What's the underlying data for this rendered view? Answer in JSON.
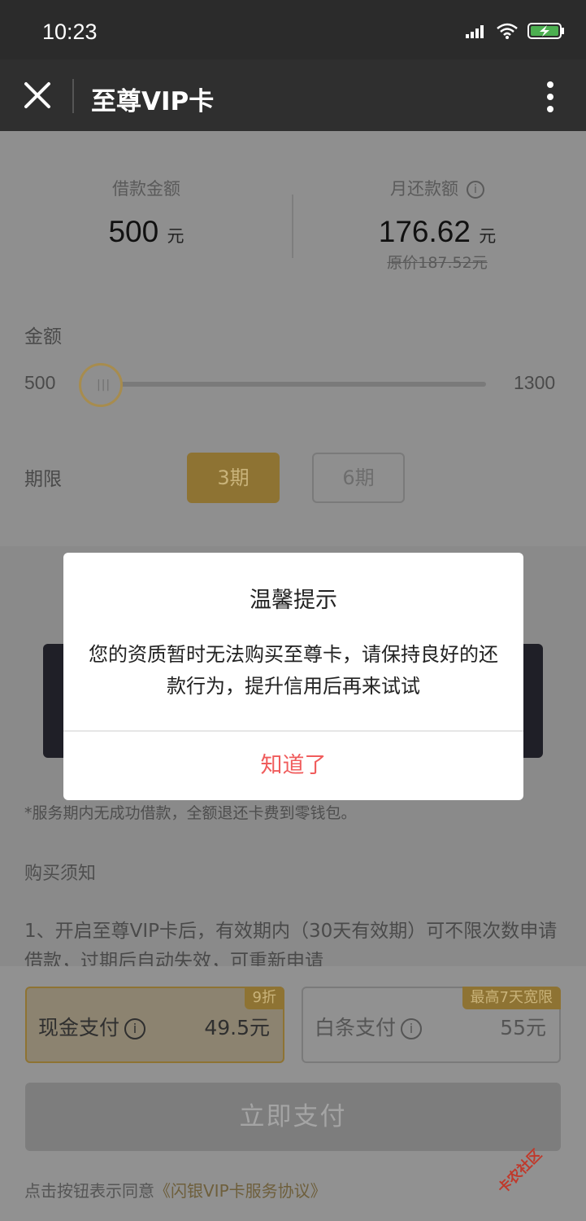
{
  "status_bar": {
    "time": "10:23"
  },
  "nav": {
    "title": "至尊VIP卡"
  },
  "loan_info": {
    "amount_label": "借款金额",
    "amount_value": "500",
    "amount_unit": "元",
    "monthly_label": "月还款额",
    "monthly_value": "176.62",
    "monthly_unit": "元",
    "original_price": "原价187.52元"
  },
  "amount_slider": {
    "label": "金额",
    "min": "500",
    "max": "1300",
    "value": 500
  },
  "period": {
    "label": "期限",
    "options": [
      "3期",
      "6期"
    ],
    "selected": "3期"
  },
  "refund_note": "*服务期内无成功借款，全额退还卡费到零钱包。",
  "purchase_notice": {
    "title": "购买须知",
    "item_1": "1、开启至尊VIP卡后，有效期内（30天有效期）可不限次数申请借款，过期后自动失效，可重新申请"
  },
  "payment": {
    "cash": {
      "label": "现金支付",
      "price": "49.5元",
      "badge": "9折"
    },
    "iou": {
      "label": "白条支付",
      "price": "55元",
      "badge": "最高7天宽限"
    },
    "pay_button": "立即支付",
    "agreement_prefix": "点击按钮表示同意",
    "agreement_link": "《闪银VIP卡服务协议》"
  },
  "dialog": {
    "title": "温馨提示",
    "message": "您的资质暂时无法购买至尊卡，请保持良好的还款行为，提升信用后再来试试",
    "confirm": "知道了"
  },
  "watermark": {
    "text": "卡农社区"
  },
  "colors": {
    "accent_gold": "#8e7333",
    "confirm_red": "#f05c5c"
  },
  "icons": [
    "close-icon",
    "more-vertical-icon",
    "signal-icon",
    "wifi-icon",
    "battery-charging-icon",
    "info-icon"
  ]
}
